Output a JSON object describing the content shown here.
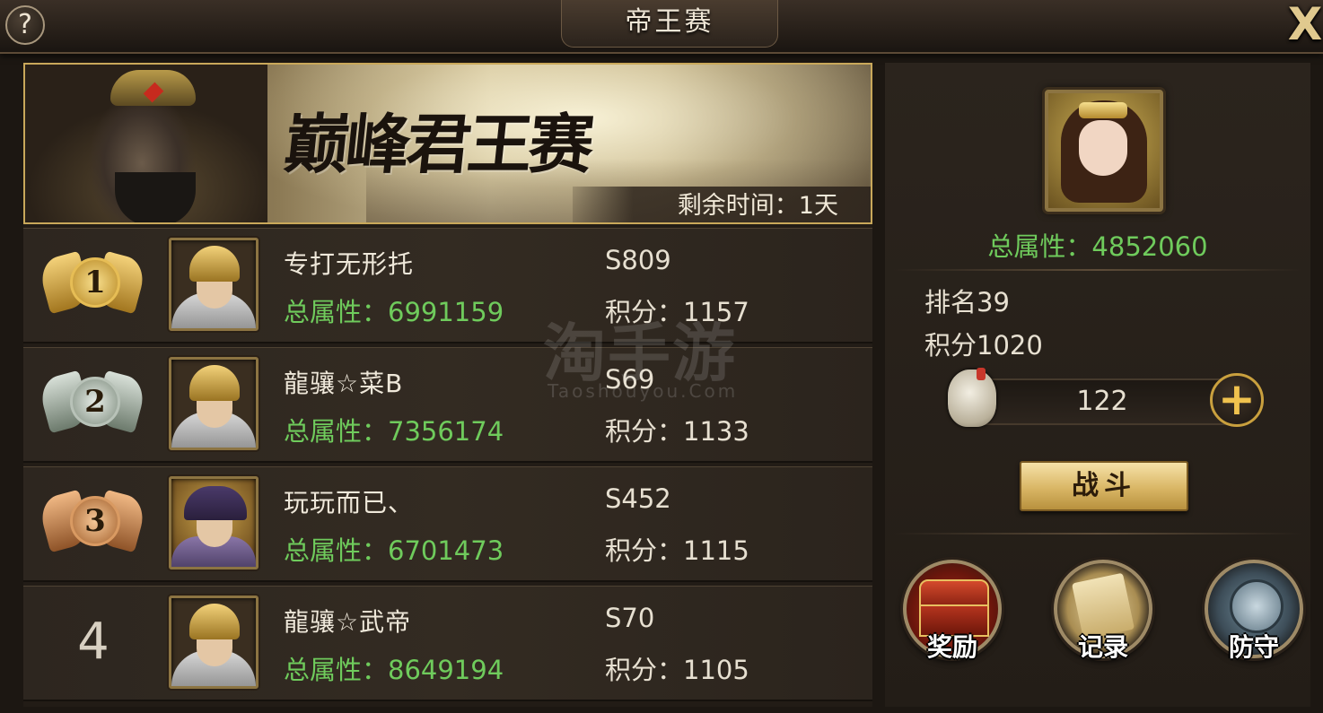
{
  "header": {
    "title": "帝王赛",
    "help_label": "?",
    "close_label": "X"
  },
  "banner": {
    "calligraphy": "巅峰君王赛",
    "time_remaining": "剩余时间：1天"
  },
  "rankings": [
    {
      "rank": "1",
      "medal": "gold",
      "name": "专打无形托",
      "server": "S809",
      "power": "总属性：6991159",
      "score": "积分：1157"
    },
    {
      "rank": "2",
      "medal": "silver",
      "name": "龍骧☆菜B",
      "server": "S69",
      "power": "总属性：7356174",
      "score": "积分：1133"
    },
    {
      "rank": "3",
      "medal": "bronze",
      "name": "玩玩而已、",
      "server": "S452",
      "power": "总属性：6701473",
      "score": "积分：1115"
    },
    {
      "rank": "4",
      "medal": "none",
      "name": "龍骧☆武帝",
      "server": "S70",
      "power": "总属性：8649194",
      "score": "积分：1105"
    }
  ],
  "watermark": {
    "main": "淘手游",
    "sub": "Taoshouyou.Com"
  },
  "player": {
    "power": "总属性：4852060",
    "rank": "排名39",
    "score": "积分1020",
    "tickets": "122",
    "add_label": "+"
  },
  "actions": {
    "fight": "战斗",
    "reward": "奖励",
    "record": "记录",
    "defend": "防守"
  },
  "colors": {
    "power_green": "#6fcb5c",
    "gold_border": "#c9a85a",
    "panel_bg": "#2b241d"
  }
}
